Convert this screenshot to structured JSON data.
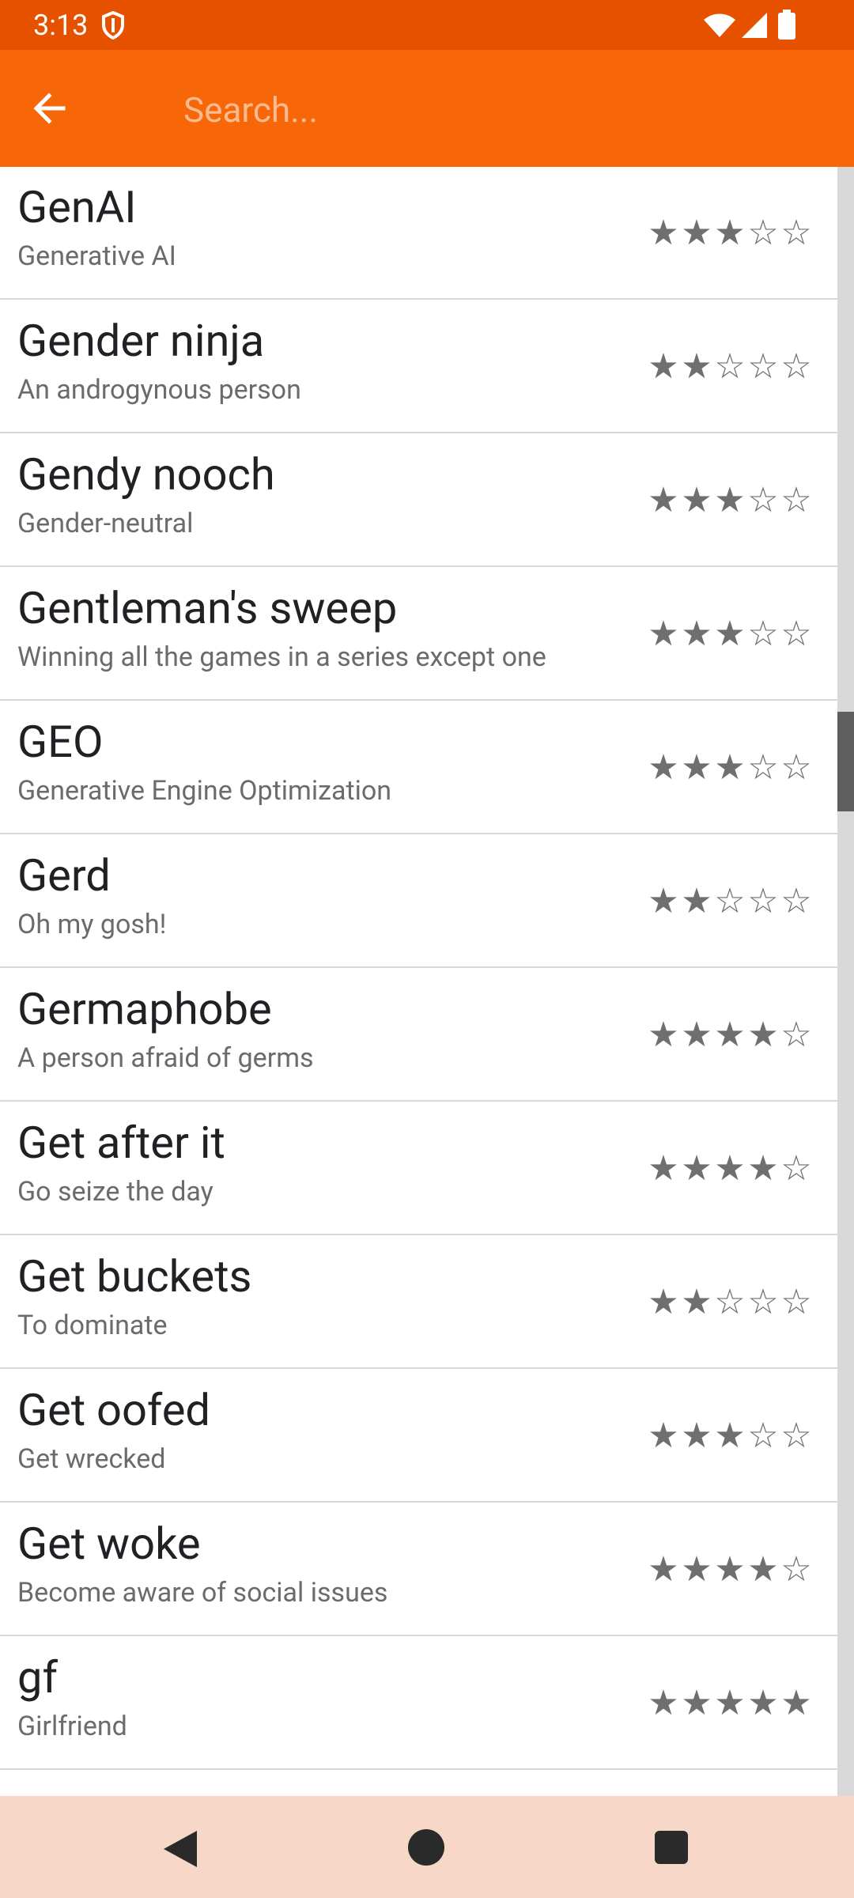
{
  "status_bar": {
    "time": "3:13"
  },
  "toolbar": {
    "search_placeholder": "Search..."
  },
  "items": [
    {
      "term": "GenAI",
      "definition": "Generative AI",
      "rating": 3
    },
    {
      "term": "Gender ninja",
      "definition": "An androgynous person",
      "rating": 2
    },
    {
      "term": "Gendy nooch",
      "definition": "Gender-neutral",
      "rating": 3
    },
    {
      "term": "Gentleman's sweep",
      "definition": "Winning all the games in a series except one",
      "rating": 3
    },
    {
      "term": "GEO",
      "definition": "Generative Engine Optimization",
      "rating": 3
    },
    {
      "term": "Gerd",
      "definition": "Oh my gosh!",
      "rating": 2
    },
    {
      "term": "Germaphobe",
      "definition": "A person afraid of germs",
      "rating": 4
    },
    {
      "term": "Get after it",
      "definition": "Go seize the day",
      "rating": 4
    },
    {
      "term": "Get buckets",
      "definition": "To dominate",
      "rating": 2
    },
    {
      "term": "Get oofed",
      "definition": "Get wrecked",
      "rating": 3
    },
    {
      "term": "Get woke",
      "definition": "Become aware of social issues",
      "rating": 4
    },
    {
      "term": "gf",
      "definition": "Girlfriend",
      "rating": 5
    }
  ],
  "colors": {
    "status_bar": "#e65100",
    "toolbar": "#f76707",
    "nav_bar": "#f6d7c8"
  },
  "icons": {
    "back": "arrow-left-icon",
    "star_filled": "★",
    "star_empty": "☆"
  }
}
